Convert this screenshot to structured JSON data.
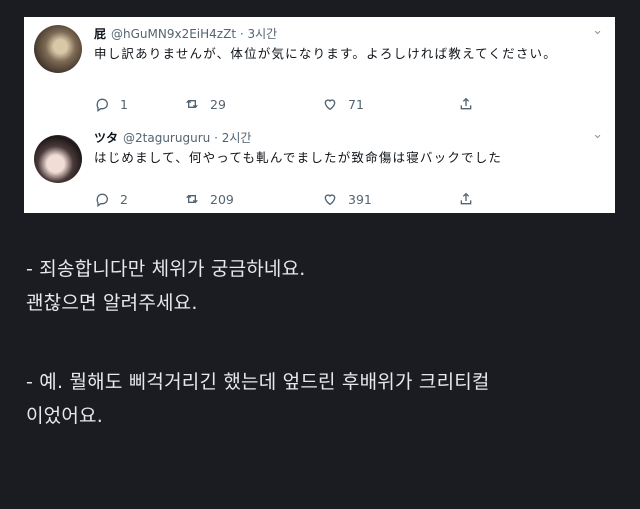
{
  "tweets": [
    {
      "name": "屁",
      "handle": "@hGuMN9x2EiH4zZt",
      "time": "· 3시간",
      "text": "申し訳ありませんが、体位が気になります。よろしければ教えてください。",
      "replies": "1",
      "retweets": "29",
      "likes": "71"
    },
    {
      "name": "ツタ",
      "handle": "@2taguruguru",
      "time": "· 2시간",
      "text": "はじめまして、何やっても軋んでましたが致命傷は寝バックでした",
      "replies": "2",
      "retweets": "209",
      "likes": "391"
    }
  ],
  "post": {
    "line1": "- 죄송합니다만 체위가 궁금하네요.",
    "line2": "괜찮으면 알려주세요.",
    "line3": "- 예. 뭘해도 삐걱거리긴 했는데 엎드린 후배위가 크리티컬",
    "line4": "이었어요."
  },
  "icons": {
    "more": "chevron-down-icon",
    "reply": "reply-icon",
    "retweet": "retweet-icon",
    "like": "heart-icon",
    "share": "share-icon"
  },
  "colors": {
    "background": "#1b1c21",
    "card": "#ffffff",
    "muted": "#536471"
  }
}
